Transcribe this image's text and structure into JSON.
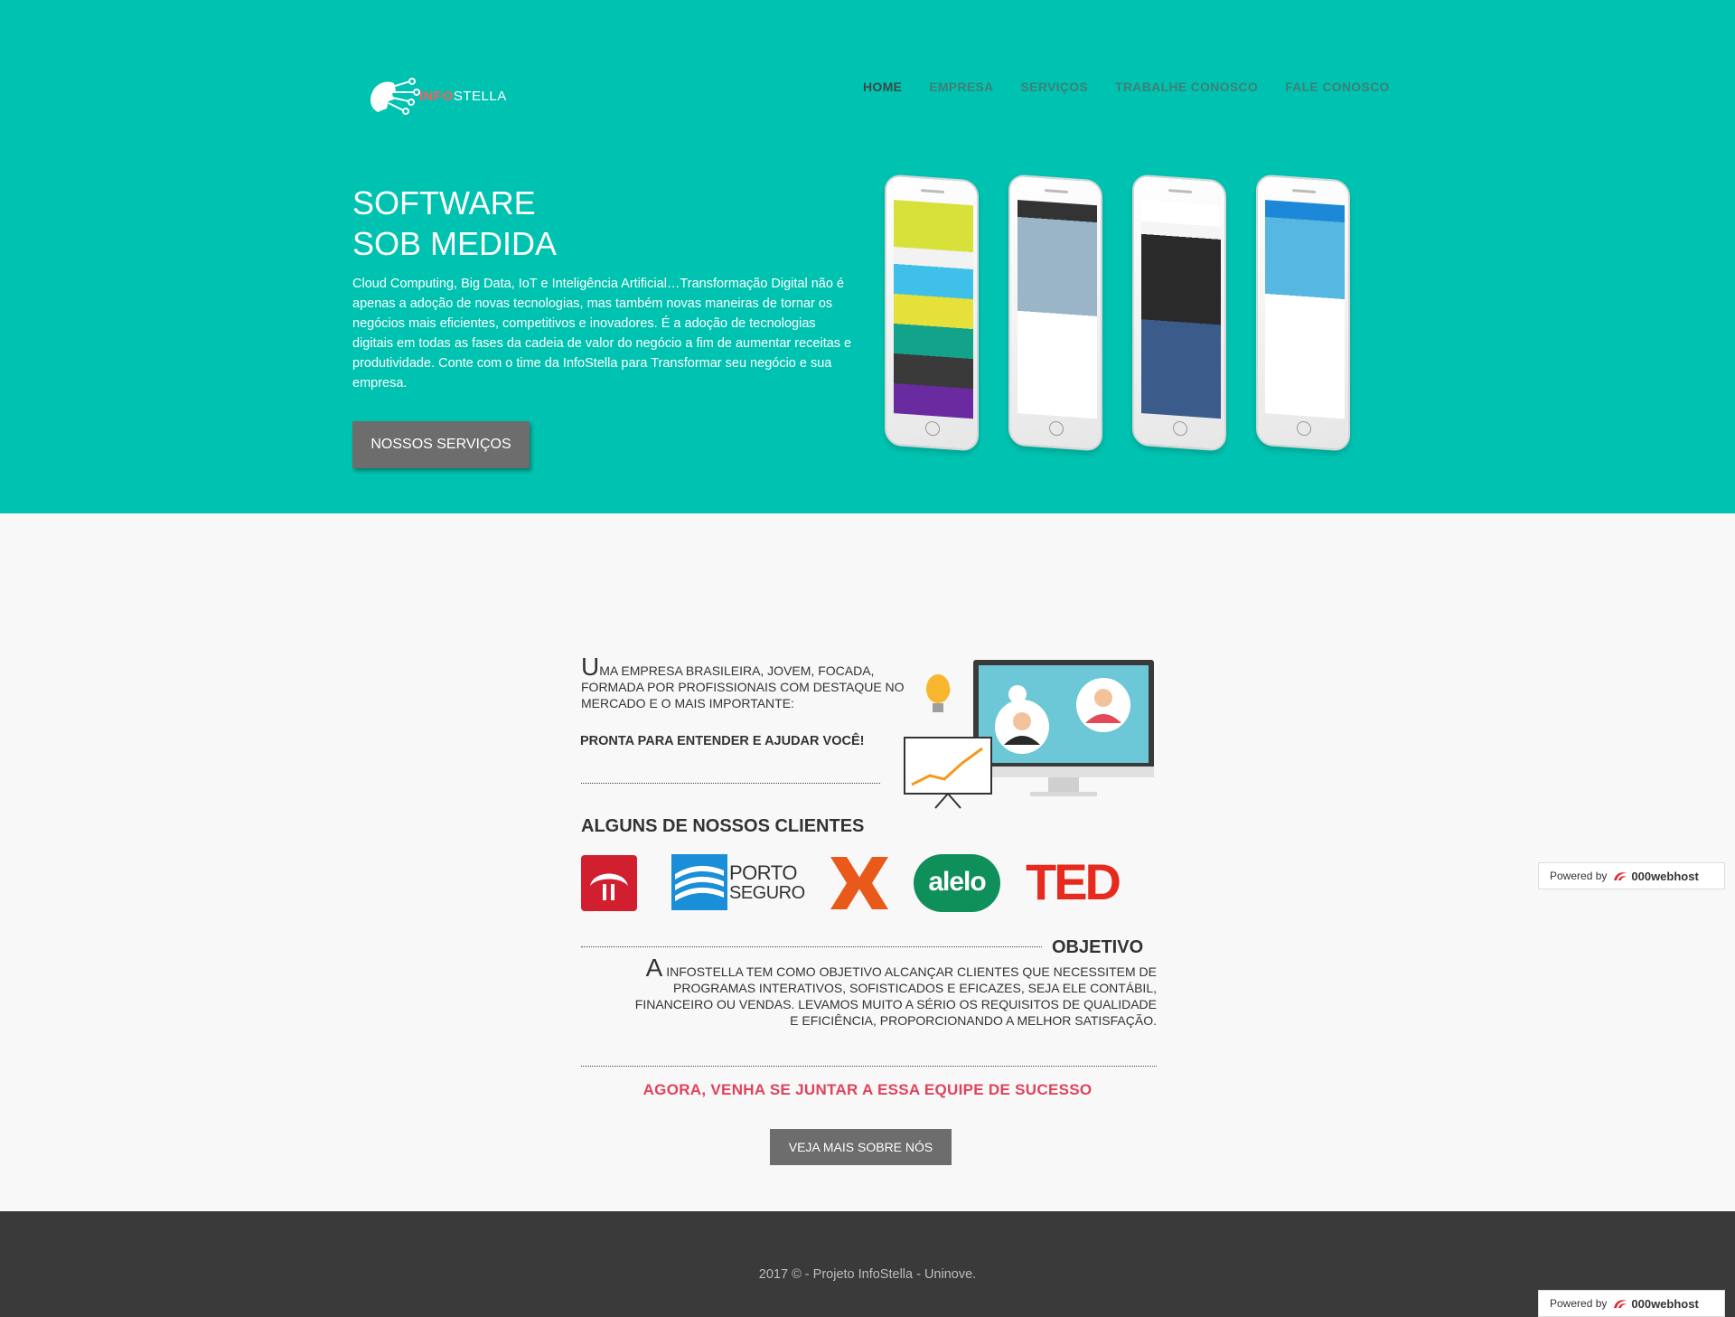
{
  "brand": {
    "logo_text_a": "INFO",
    "logo_text_b": "STELLA"
  },
  "nav": {
    "items": [
      {
        "label": "HOME"
      },
      {
        "label": "EMPRESA"
      },
      {
        "label": "SERVIÇOS"
      },
      {
        "label": "TRABALHE CONOSCO"
      },
      {
        "label": "FALE CONOSCO"
      }
    ]
  },
  "hero": {
    "title_line1": "SOFTWARE",
    "title_line2": "SOB MEDIDA",
    "text": "Cloud Computing, Big Data, IoT e Inteligência Artificial…Transformação Digital não é apenas a adoção de novas tecnologias, mas também novas maneiras de tornar os negócios mais eficientes, competitivos e inovadores. É a adoção de tecnologias digitais em todas as fases da cadeia de valor do negócio a fim de aumentar receitas e produtividade. Conte com o time da InfoStella para Transformar seu negócio e sua empresa.",
    "button": "NOSSOS SERVIÇOS"
  },
  "intro": {
    "cap": "U",
    "text": "ma empresa brasileira, jovem, focada, formada por profissionais com destaque no mercado e o mais importante:",
    "strong": "PRONTA PARA ENTENDER E AJUDAR VOCÊ!"
  },
  "clients": {
    "title": "ALGUNS DE NOSSOS CLIENTES",
    "porto_line1": "PORTO",
    "porto_line2": "SEGURO",
    "alelo": "alelo",
    "ted": "TED"
  },
  "objetivo": {
    "title": "OBJETIVO",
    "cap": "A",
    "text": " InfoStella tem como objetivo alcançar clientes que necessitem de programas interativos, sofisticados e eficazes, seja ele contábil, financeiro ou vendas. Levamos muito a sério os requisitos de qualidade e eficiência, proporcionando a melhor satisfação."
  },
  "cta": {
    "text": "AGORA, VENHA SE JUNTAR A ESSA EQUIPE DE SUCESSO",
    "button": "VEJA MAIS SOBRE NÓS"
  },
  "footer": {
    "text": "2017 © - Projeto InfoStella - Uninove."
  },
  "powered": {
    "label": "Powered by",
    "brand": "000webhost"
  },
  "colors": {
    "hero_bg": "#00c2b0",
    "button_gray": "#6d6d6d",
    "cta_red": "#e0425c",
    "footer_bg": "#3a3a3a"
  }
}
